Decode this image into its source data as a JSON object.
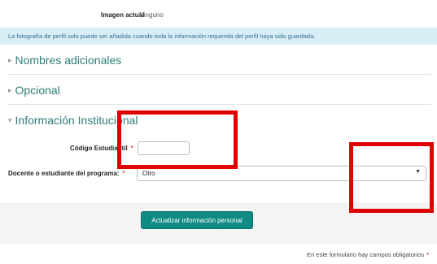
{
  "current_image": {
    "label": "Imagen actual",
    "value": "Ninguno"
  },
  "info_alert": "La fotografía de perfil solo puede ser añadida cuando toda la información requerida del perfil haya sido guardada.",
  "sections": {
    "additional_names": {
      "title": "Nombres adicionales",
      "caret": "▸"
    },
    "optional": {
      "title": "Opcional",
      "caret": "▸"
    },
    "institutional": {
      "title": "Información Institucional",
      "caret": "▾"
    }
  },
  "fields": {
    "student_code": {
      "label": "Código Estudiantil",
      "required_mark": "*",
      "value": ""
    },
    "program_role": {
      "label": "Docente o estudiante del programa:",
      "required_mark": "*",
      "selected": "Otro",
      "arrow": "▼"
    }
  },
  "submit_button": "Actualizar información personal",
  "required_note": {
    "text": "En este formulario hay campos obligatorios",
    "mark": "*"
  },
  "colors": {
    "accent": "#0f8b84",
    "section_title": "#2f7d78",
    "alert_bg": "#d9edf7",
    "required": "#d9534f",
    "annotation": "#e00000"
  }
}
